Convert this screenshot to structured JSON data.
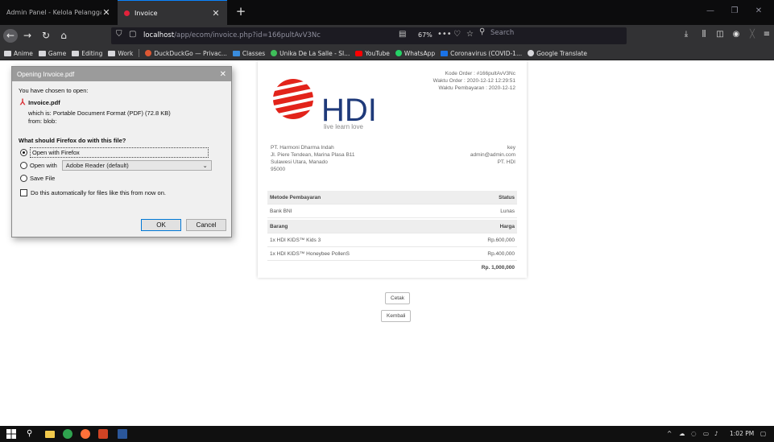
{
  "browser": {
    "tabs": [
      {
        "label": "Admin Panel - Kelola Pelanggan"
      },
      {
        "label": "Invoice"
      }
    ],
    "url_host": "localhost",
    "url_path": "/app/ecom/invoice.php?id=166pultAvV3Nc",
    "zoom": "67%",
    "search_placeholder": "Search",
    "bookmarks": [
      {
        "label": "Anime",
        "color": "#d7d7db"
      },
      {
        "label": "Game",
        "color": "#d7d7db"
      },
      {
        "label": "Editing",
        "color": "#d7d7db"
      },
      {
        "label": "Work",
        "color": "#d7d7db"
      },
      {
        "label": "DuckDuckGo — Privac...",
        "color": "#de5833"
      },
      {
        "label": "Classes",
        "color": "#3a8cdd"
      },
      {
        "label": "Unika De La Salle - SI...",
        "color": "#3fbf5a"
      },
      {
        "label": "YouTube",
        "color": "#ff0000"
      },
      {
        "label": "WhatsApp",
        "color": "#25d366"
      },
      {
        "label": "Coronavirus (COVID-1...",
        "color": "#1a73e8"
      },
      {
        "label": "Google Translate",
        "color": "#d7d7db"
      }
    ]
  },
  "invoice": {
    "brand": "HDI",
    "tagline": "live learn love",
    "order_code": "Kode Order : #166pultAvV3Nc",
    "order_time": "Waktu Order : 2020-12-12 12:29:51",
    "payment_time": "Waktu Pembayaran : 2020-12-12",
    "address_left": [
      "PT. Harmoni Dharma Indah",
      "Jl. Piere Tendean, Marina Plasa B11",
      "Sulawesi Utara, Manado",
      "95000"
    ],
    "address_right": [
      "key",
      "admin@admin.com",
      "PT. HDI"
    ],
    "payment_header": {
      "left": "Metode Pembayaran",
      "right": "Status"
    },
    "payment_row": {
      "left": "Bank BNI",
      "right": "Lunas"
    },
    "items_header": {
      "left": "Barang",
      "right": "Harga"
    },
    "items": [
      {
        "name": "1x HDI KIDS™ Kids 3",
        "price": "Rp.600,000"
      },
      {
        "name": "1x HDI KIDS™ Honeybee PollenS",
        "price": "Rp.400,000"
      }
    ],
    "total": "Rp. 1,000,000",
    "print_label": "Cetak",
    "back_label": "Kembali",
    "brand_color": "#e2231a"
  },
  "dialog": {
    "title": "Opening Invoice.pdf",
    "intro": "You have chosen to open:",
    "filename": "Invoice.pdf",
    "which_is": "which is: Portable Document Format (PDF) (72.8 KB)",
    "from": "from: blob:",
    "question": "What should Firefox do with this file?",
    "option_firefox": "Open with Firefox",
    "option_open_with": "Open with",
    "open_with_value": "Adobe Reader (default)",
    "option_save": "Save File",
    "auto_label": "Do this automatically for files like this from now on.",
    "ok_label": "OK",
    "cancel_label": "Cancel"
  },
  "taskbar": {
    "time": "1:02 PM"
  }
}
